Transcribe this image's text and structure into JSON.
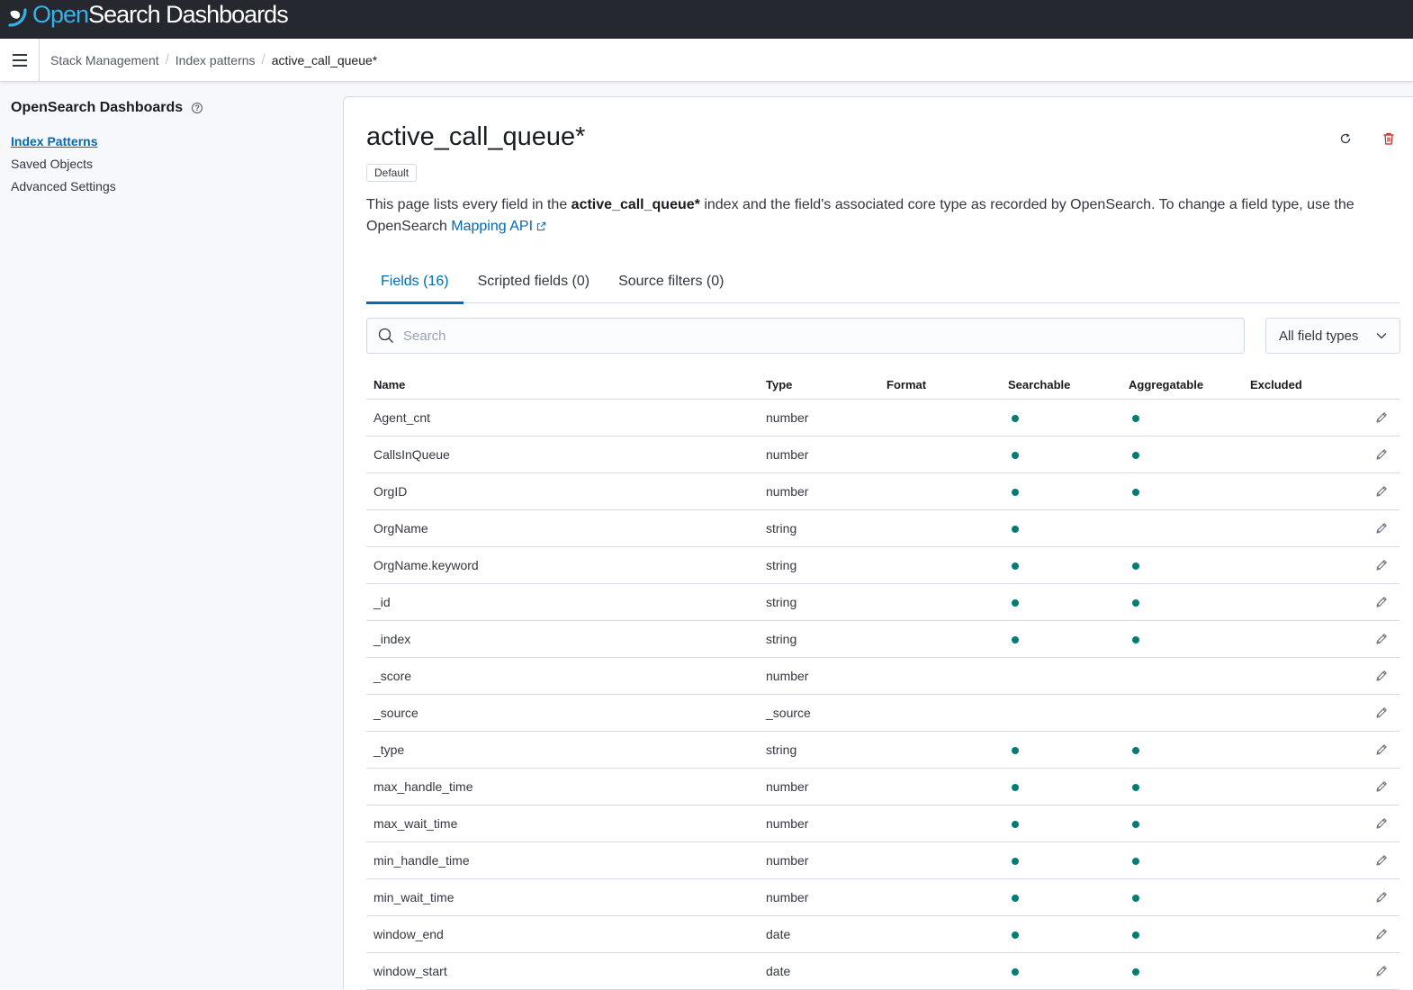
{
  "colors": {
    "topbar": "#25282f",
    "accent": "#006bb4",
    "dot": "#017d73",
    "danger": "#bd271e"
  },
  "header": {
    "brand_open": "Open",
    "brand_rest": "Search Dashboards"
  },
  "breadcrumbs": [
    "Stack Management",
    "Index patterns",
    "active_call_queue*"
  ],
  "sidebar": {
    "title": "OpenSearch Dashboards",
    "items": [
      {
        "label": "Index Patterns",
        "active": true
      },
      {
        "label": "Saved Objects",
        "active": false
      },
      {
        "label": "Advanced Settings",
        "active": false
      }
    ]
  },
  "page": {
    "title": "active_call_queue*",
    "badge": "Default",
    "desc_pre": "This page lists every field in the ",
    "desc_bold": "active_call_queue*",
    "desc_mid": " index and the field's associated core type as recorded by OpenSearch. To change a field type, use the OpenSearch ",
    "desc_link": "Mapping API",
    "refresh_icon": "refresh-icon",
    "delete_icon": "trash-icon"
  },
  "tabs": [
    {
      "label": "Fields (16)",
      "active": true
    },
    {
      "label": "Scripted fields (0)",
      "active": false
    },
    {
      "label": "Source filters (0)",
      "active": false
    }
  ],
  "search": {
    "placeholder": "Search",
    "value": ""
  },
  "filter": {
    "selected": "All field types"
  },
  "table": {
    "headers": {
      "name": "Name",
      "type": "Type",
      "format": "Format",
      "searchable": "Searchable",
      "aggregatable": "Aggregatable",
      "excluded": "Excluded"
    },
    "rows": [
      {
        "name": "Agent_cnt",
        "type": "number",
        "searchable": true,
        "aggregatable": true
      },
      {
        "name": "CallsInQueue",
        "type": "number",
        "searchable": true,
        "aggregatable": true
      },
      {
        "name": "OrgID",
        "type": "number",
        "searchable": true,
        "aggregatable": true
      },
      {
        "name": "OrgName",
        "type": "string",
        "searchable": true,
        "aggregatable": false
      },
      {
        "name": "OrgName.keyword",
        "type": "string",
        "searchable": true,
        "aggregatable": true
      },
      {
        "name": "_id",
        "type": "string",
        "searchable": true,
        "aggregatable": true
      },
      {
        "name": "_index",
        "type": "string",
        "searchable": true,
        "aggregatable": true
      },
      {
        "name": "_score",
        "type": "number",
        "searchable": false,
        "aggregatable": false
      },
      {
        "name": "_source",
        "type": "_source",
        "searchable": false,
        "aggregatable": false
      },
      {
        "name": "_type",
        "type": "string",
        "searchable": true,
        "aggregatable": true
      },
      {
        "name": "max_handle_time",
        "type": "number",
        "searchable": true,
        "aggregatable": true
      },
      {
        "name": "max_wait_time",
        "type": "number",
        "searchable": true,
        "aggregatable": true
      },
      {
        "name": "min_handle_time",
        "type": "number",
        "searchable": true,
        "aggregatable": true
      },
      {
        "name": "min_wait_time",
        "type": "number",
        "searchable": true,
        "aggregatable": true
      },
      {
        "name": "window_end",
        "type": "date",
        "searchable": true,
        "aggregatable": true
      },
      {
        "name": "window_start",
        "type": "date",
        "searchable": true,
        "aggregatable": true
      }
    ]
  }
}
